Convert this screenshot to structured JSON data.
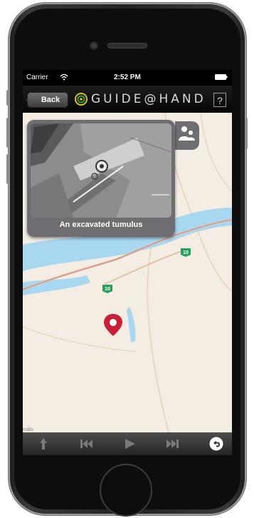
{
  "status_bar": {
    "carrier": "Carrier",
    "time": "2:52 PM"
  },
  "nav_bar": {
    "back_label": "Back",
    "logo_text": "GUIDE@HAND",
    "help_label": "?"
  },
  "info_card": {
    "caption": "An excavated tumulus"
  },
  "map": {
    "road_badges": [
      "10",
      "10"
    ],
    "attribution": "måls"
  },
  "toolbar": {
    "items": [
      "up-arrow-icon",
      "skip-back-icon",
      "play-icon",
      "skip-forward-icon",
      "return-icon"
    ]
  },
  "colors": {
    "map_land": "#f3ede4",
    "map_water": "#a8d7f0",
    "map_road": "#e9c9a8",
    "pin": "#c91f37",
    "road_badge": "#21a05c",
    "card": "#6e6e72"
  }
}
